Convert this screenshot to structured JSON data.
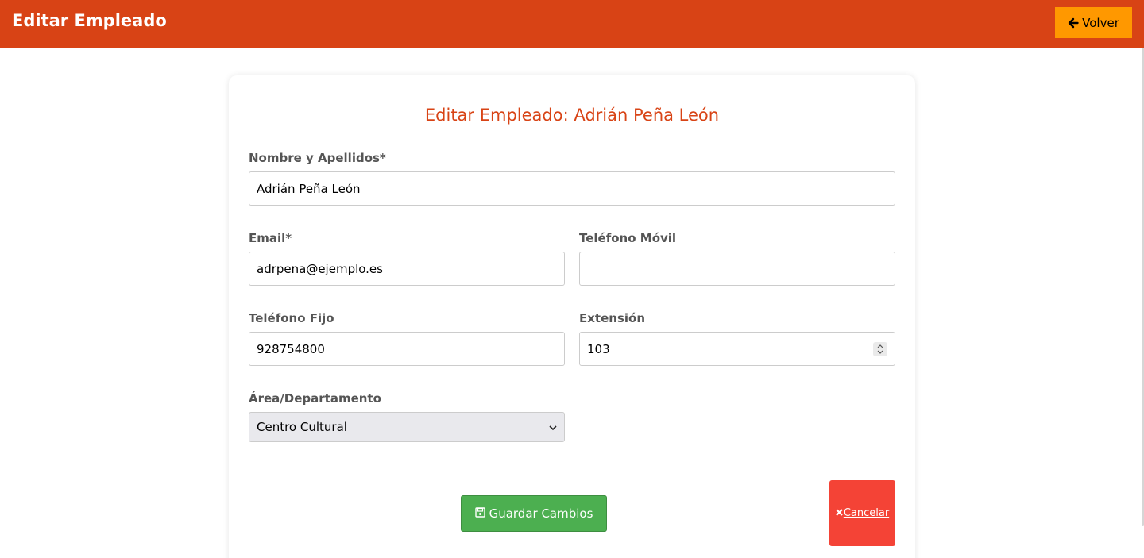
{
  "header": {
    "title": "Editar Empleado",
    "back_label": "Volver",
    "back_icon": "arrow-left-icon"
  },
  "form": {
    "heading": "Editar Empleado: Adrián Peña León",
    "fields": {
      "full_name": {
        "label": "Nombre y Apellidos*",
        "value": "Adrián Peña León"
      },
      "email": {
        "label": "Email*",
        "value": "adrpena@ejemplo.es"
      },
      "mobile": {
        "label": "Teléfono Móvil",
        "value": ""
      },
      "landline": {
        "label": "Teléfono Fijo",
        "value": "928754800"
      },
      "extension": {
        "label": "Extensión",
        "value": "103"
      },
      "department": {
        "label": "Área/Departamento",
        "selected": "Centro Cultural"
      }
    },
    "save_label": "Guardar Cambios",
    "save_icon": "floppy-disk-icon",
    "cancel_label": "Cancelar",
    "cancel_icon": "close-icon"
  },
  "colors": {
    "header": "#d84315",
    "back_button": "#ff9800",
    "heading": "#d84315",
    "save_button": "#4caf50",
    "cancel_button": "#f44336"
  }
}
